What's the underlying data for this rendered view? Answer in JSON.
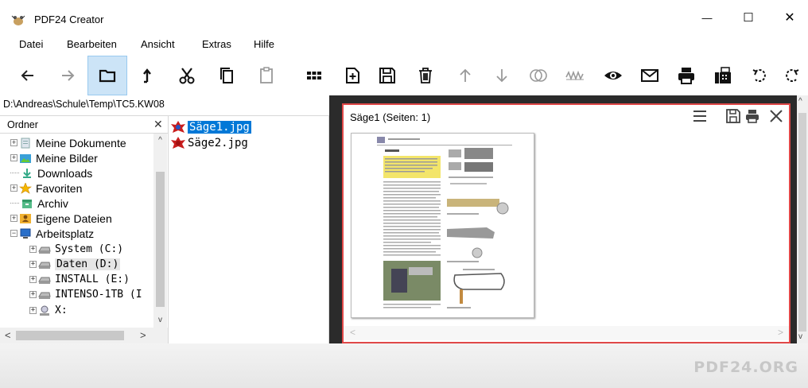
{
  "window": {
    "title": "PDF24 Creator",
    "min": "—",
    "max": "☐",
    "close": "✕"
  },
  "menu": [
    "Datei",
    "Bearbeiten",
    "Ansicht",
    "Extras",
    "Hilfe"
  ],
  "toolbar": {
    "icons": [
      "back-icon",
      "forward-icon",
      "folder-icon",
      "up-arrow-icon",
      "scissors-icon",
      "copy-icon",
      "paste-icon",
      "grid-icon",
      "new-file-icon",
      "save-icon",
      "delete-icon",
      "move-up-icon",
      "move-down-icon",
      "merge-icon",
      "sign-icon",
      "view-icon",
      "mail-icon",
      "print-icon",
      "fax-icon",
      "rotate-left-icon",
      "rotate-right-icon"
    ],
    "active": "folder-icon"
  },
  "path": "D:\\Andreas\\Schule\\Temp\\TC5.KW08",
  "folders": {
    "header": "Ordner",
    "close": "✕",
    "items": [
      {
        "label": "Meine Dokumente",
        "level": 0,
        "expander": "+",
        "icon": "documents-icon"
      },
      {
        "label": "Meine Bilder",
        "level": 0,
        "expander": "+",
        "icon": "pictures-icon"
      },
      {
        "label": "Downloads",
        "level": 0,
        "expander": "",
        "icon": "downloads-icon"
      },
      {
        "label": "Favoriten",
        "level": 0,
        "expander": "+",
        "icon": "star-icon"
      },
      {
        "label": "Archiv",
        "level": 0,
        "expander": "",
        "icon": "archive-icon"
      },
      {
        "label": "Eigene Dateien",
        "level": 0,
        "expander": "+",
        "icon": "user-files-icon"
      },
      {
        "label": "Arbeitsplatz",
        "level": 0,
        "expander": "−",
        "icon": "computer-icon"
      },
      {
        "label": "System (C:)",
        "level": 1,
        "expander": "+",
        "icon": "drive-icon"
      },
      {
        "label": "Daten (D:)",
        "level": 1,
        "expander": "+",
        "icon": "drive-icon",
        "selected": true
      },
      {
        "label": "INSTALL (E:)",
        "level": 1,
        "expander": "+",
        "icon": "drive-icon"
      },
      {
        "label": "INTENSO-1TB (I",
        "level": 1,
        "expander": "+",
        "icon": "drive-icon"
      },
      {
        "label": "X:",
        "level": 1,
        "expander": "+",
        "icon": "network-drive-icon"
      }
    ]
  },
  "files": [
    {
      "name": "Säge1.jpg",
      "selected": true
    },
    {
      "name": "Säge2.jpg",
      "selected": false
    }
  ],
  "preview": {
    "title": "Säge1 (Seiten: 1)"
  },
  "brand": "PDF24.ORG"
}
